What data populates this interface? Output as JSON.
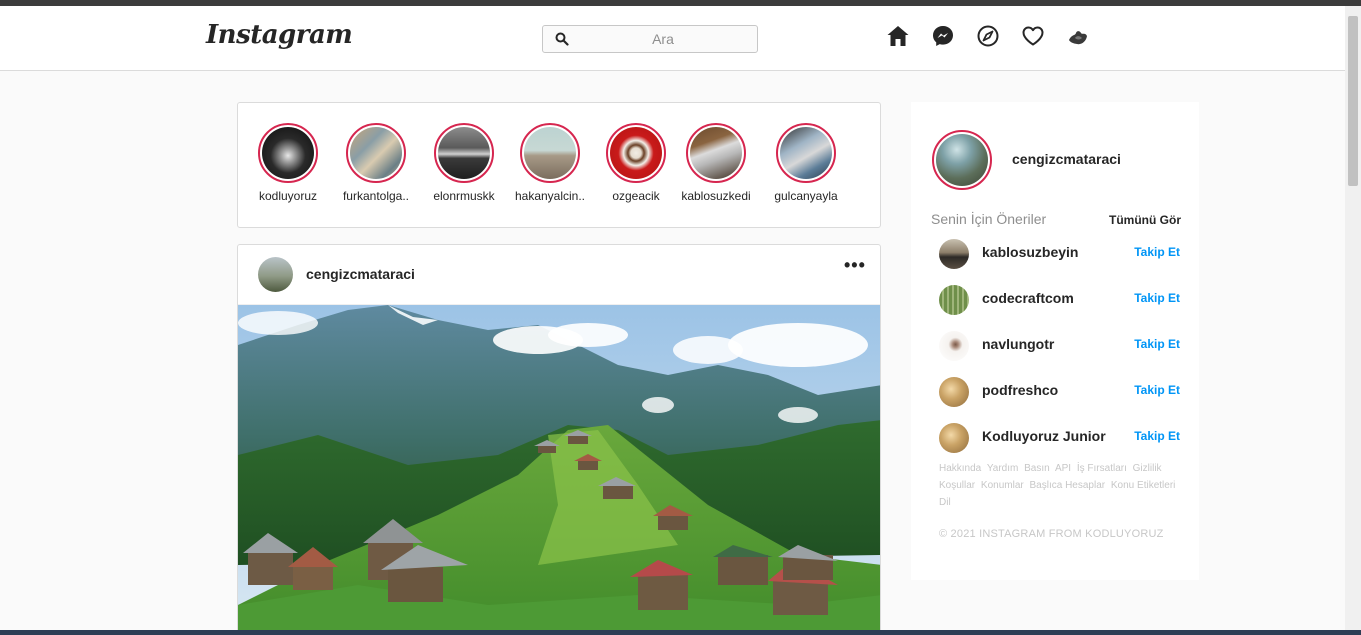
{
  "header": {
    "logo": "Instagram",
    "search_placeholder": "Ara",
    "nav_icons": [
      "home-icon",
      "messenger-icon",
      "explore-compass-icon",
      "heart-icon",
      "profile-avatar-icon"
    ]
  },
  "stories": [
    {
      "username": "kodluyoruz",
      "image": "dark-pier"
    },
    {
      "username": "furkantolga..",
      "image": "harbor-aerial"
    },
    {
      "username": "elonrmuskk",
      "image": "city-skyline-bw"
    },
    {
      "username": "hakanyalcin..",
      "image": "building-sky"
    },
    {
      "username": "ozgeacik",
      "image": "coffee-cup-red"
    },
    {
      "username": "kablosuzkedi",
      "image": "laptop-desk"
    },
    {
      "username": "gulcanyayla",
      "image": "laptop-workspace"
    }
  ],
  "post": {
    "username": "cengizcmataraci",
    "more_label": "•••",
    "image": "mountain-plateau-village"
  },
  "sidebar": {
    "username": "cengizcmataraci",
    "suggestions_title": "Senin İçin Öneriler",
    "see_all": "Tümünü Gör",
    "suggestions": [
      {
        "username": "kablosuzbeyin",
        "follow": "Takip Et"
      },
      {
        "username": "codecraftcom",
        "follow": "Takip Et"
      },
      {
        "username": "navlungotr",
        "follow": "Takip Et"
      },
      {
        "username": "podfreshco",
        "follow": "Takip Et"
      },
      {
        "username": "Kodluyoruz Junior",
        "follow": "Takip Et"
      }
    ],
    "footer_links": [
      "Hakkında",
      "Yardım",
      "Basın",
      "API",
      "İş Fırsatları",
      "Gizlilik",
      "Koşullar",
      "Konumlar",
      "Başlıca Hesaplar",
      "Konu Etiketleri",
      "Dil"
    ],
    "copyright": "© 2021 INSTAGRAM FROM KODLUYORUZ"
  },
  "colors": {
    "story_ring": "#d6264f",
    "follow_link": "#0095f6",
    "background": "#fafafa"
  }
}
